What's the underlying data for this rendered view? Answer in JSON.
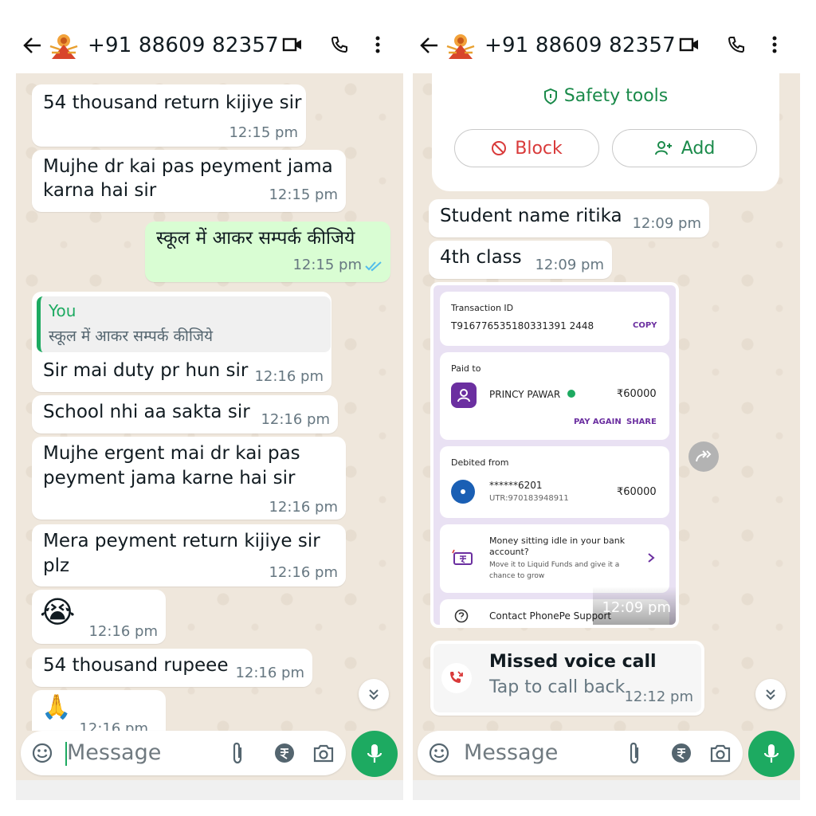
{
  "colors": {
    "accent_green": "#1daa61",
    "outgoing_bubble": "#d9fdd3",
    "chat_background": "#efe7dc",
    "danger_red": "#d93a3a",
    "phonepe_purple": "#6b2fa0",
    "tick_blue": "#53bdeb"
  },
  "left": {
    "header": {
      "title": "+91 88609 82357",
      "icons": [
        "back-arrow-icon",
        "durga-avatar",
        "video-call-icon",
        "voice-call-icon",
        "more-vert-icon"
      ]
    },
    "messages": [
      {
        "text": "54 thousand return kijiye sir",
        "time": "12:15 pm"
      },
      {
        "line1": "Mujhe dr kai pas peyment jama",
        "line2": "karna hai sir",
        "time": "12:15 pm"
      },
      {
        "text": "स्कूल में आकर सम्पर्क कीजिये",
        "time": "12:15 pm",
        "outgoing": true
      },
      {
        "quote_author": "You",
        "quote_text": "स्कूल में आकर सम्पर्क कीजिये",
        "text": "Sir mai duty pr hun sir",
        "time": "12:16 pm"
      },
      {
        "text": "School nhi aa sakta sir",
        "time": "12:16 pm"
      },
      {
        "line1": "Mujhe ergent mai dr kai pas",
        "line2": "peyment jama karne hai sir",
        "time": "12:16 pm"
      },
      {
        "line1": "Mera peyment return kijiye sir",
        "line2": "plz",
        "time": "12:16 pm"
      },
      {
        "emoji": "😭",
        "time": "12:16 pm"
      },
      {
        "text": "54 thousand rupeee",
        "time": "12:16 pm"
      },
      {
        "emoji": "🙏",
        "time": "12:16 pm"
      }
    ],
    "input": {
      "placeholder": "Message"
    }
  },
  "right": {
    "header": {
      "title": "+91 88609 82357"
    },
    "safety": {
      "safety_tools": "Safety tools",
      "block": "Block",
      "add": "Add"
    },
    "messages": [
      {
        "text": "Student name ritika",
        "time": "12:09 pm"
      },
      {
        "text": "4th class",
        "time": "12:09 pm"
      }
    ],
    "receipt": {
      "transaction_id_label": "Transaction ID",
      "transaction_id": "T916776535180331391 2448",
      "copy": "COPY",
      "paid_to_label": "Paid to",
      "payee": "PRINCY PAWAR",
      "amount": "₹60000",
      "pay_again": "PAY AGAIN",
      "share": "SHARE",
      "debited_from_label": "Debited from",
      "account": "******6201",
      "utr": "UTR:970183948911",
      "debited_amount": "₹60000",
      "promo_title_1": "Money sitting idle in your bank",
      "promo_title_2": "account?",
      "promo_sub_1": "Move it to Liquid Funds and give it a",
      "promo_sub_2": "chance to grow",
      "support": "Contact PhonePe Support",
      "time": "12:09 pm"
    },
    "missed_call": {
      "title": "Missed voice call",
      "subtitle": "Tap to call back",
      "time": "12:12 pm"
    },
    "input": {
      "placeholder": "Message"
    }
  }
}
